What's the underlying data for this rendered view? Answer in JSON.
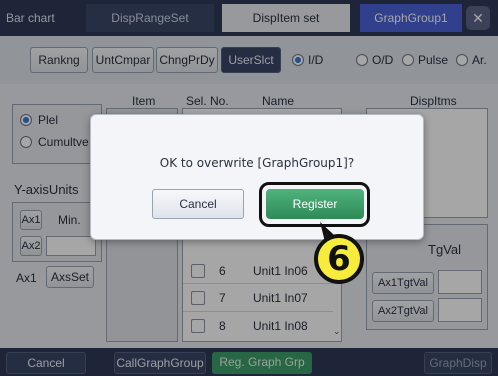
{
  "tabs": {
    "bar_chart": "Bar chart",
    "disp_range_set": "DispRangeSet",
    "disp_item_set": "DispItem set",
    "graph_group": "GraphGroup1"
  },
  "toolbar": {
    "ranking": "Rankng",
    "unit_compare": "UntCmpar",
    "change_prdy": "ChngPrDy",
    "user_select": "UserSlct"
  },
  "source_radios": [
    "I/D",
    "O/D",
    "Pulse",
    "Ar."
  ],
  "left_panel": {
    "plel": "Plel",
    "cumulative": "Cumultve",
    "y_axis_units": "Y-axisUnits",
    "ax1": "Ax1",
    "min": "Min.",
    "ax2": "Ax2",
    "ax1_b": "Ax1",
    "axis_set": "AxsSet"
  },
  "table_headers": {
    "item": "Item",
    "sel_no": "Sel. No.",
    "name": "Name",
    "disp_items": "DispItms"
  },
  "rows": [
    {
      "no": "6",
      "name": "Unit1 In06"
    },
    {
      "no": "7",
      "name": "Unit1 In07"
    },
    {
      "no": "8",
      "name": "Unit1 In08"
    }
  ],
  "right_panel": {
    "tgt_val": "TgVal",
    "ax1_tgt_val": "Ax1TgtVal",
    "ax2_tgt_val": "Ax2TgtVal"
  },
  "bottom": {
    "cancel": "Cancel",
    "call_graph_group": "CallGraphGroup",
    "reg_graph_grp": "Reg. Graph Grp",
    "graph_disp": "GraphDisp"
  },
  "dialog": {
    "message": "OK to overwrite [GraphGroup1]?",
    "cancel": "Cancel",
    "register": "Register"
  },
  "step_badge": "6",
  "colors": {
    "accent_blue": "#4a63d8",
    "register_green": "#3e9e6a",
    "badge_yellow": "#f7ec3c"
  }
}
